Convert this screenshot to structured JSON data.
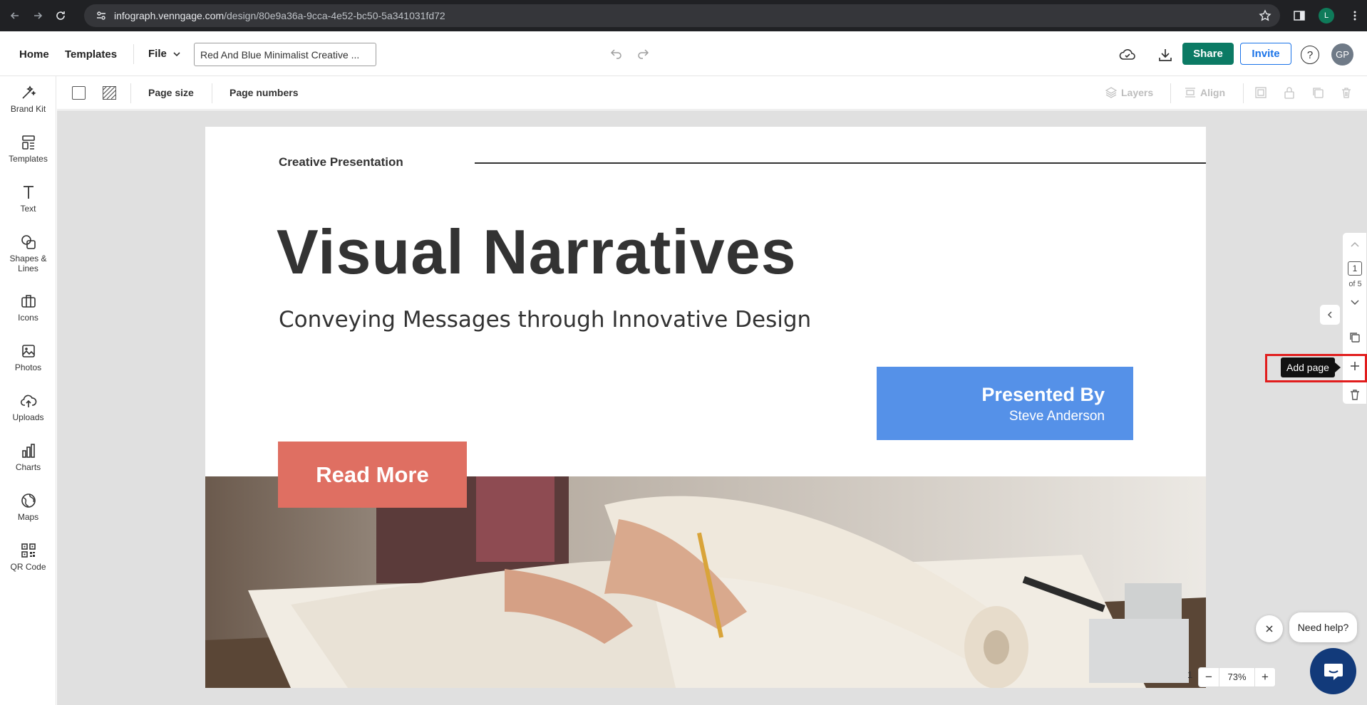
{
  "browser": {
    "url_host": "infograph.venngage.com",
    "url_path": "/design/80e9a36a-9cca-4e52-bc50-5a341031fd72",
    "profile_initial": "L"
  },
  "header": {
    "home_label": "Home",
    "templates_label": "Templates",
    "file_label": "File",
    "design_title": "Red And Blue Minimalist Creative ...",
    "share_label": "Share",
    "invite_label": "Invite",
    "help_label": "?",
    "avatar_initials": "GP"
  },
  "sidebar": {
    "items": [
      {
        "label": "Brand Kit",
        "icon": "magic-wand-icon"
      },
      {
        "label": "Templates",
        "icon": "templates-icon"
      },
      {
        "label": "Text",
        "icon": "text-icon"
      },
      {
        "label": "Shapes &\nLines",
        "icon": "shapes-icon"
      },
      {
        "label": "Icons",
        "icon": "briefcase-icon"
      },
      {
        "label": "Photos",
        "icon": "image-icon"
      },
      {
        "label": "Uploads",
        "icon": "cloud-upload-icon"
      },
      {
        "label": "Charts",
        "icon": "bar-chart-icon"
      },
      {
        "label": "Maps",
        "icon": "globe-icon"
      },
      {
        "label": "QR Code",
        "icon": "qr-code-icon"
      }
    ]
  },
  "toolbar": {
    "page_size_label": "Page size",
    "page_numbers_label": "Page numbers",
    "layers_label": "Layers",
    "align_label": "Align"
  },
  "slide": {
    "kicker": "Creative Presentation",
    "title": "Visual Narratives",
    "subtitle": "Conveying Messages through Innovative Design",
    "presented_by": "Presented By",
    "presenter": "Steve Anderson",
    "cta": "Read More"
  },
  "rail": {
    "current_page": "1",
    "page_total": "of 5",
    "add_page_tooltip": "Add page"
  },
  "footer": {
    "page_number": "1",
    "zoom_minus": "−",
    "zoom_value": "73%",
    "zoom_plus": "+",
    "need_help": "Need help?"
  },
  "colors": {
    "share_green": "#0b7a64",
    "invite_blue": "#1a73e8",
    "presented_box": "#5591e8",
    "cta_salmon": "#df6f62",
    "highlight_red": "#e11d1d",
    "chat_navy": "#123a7a"
  }
}
